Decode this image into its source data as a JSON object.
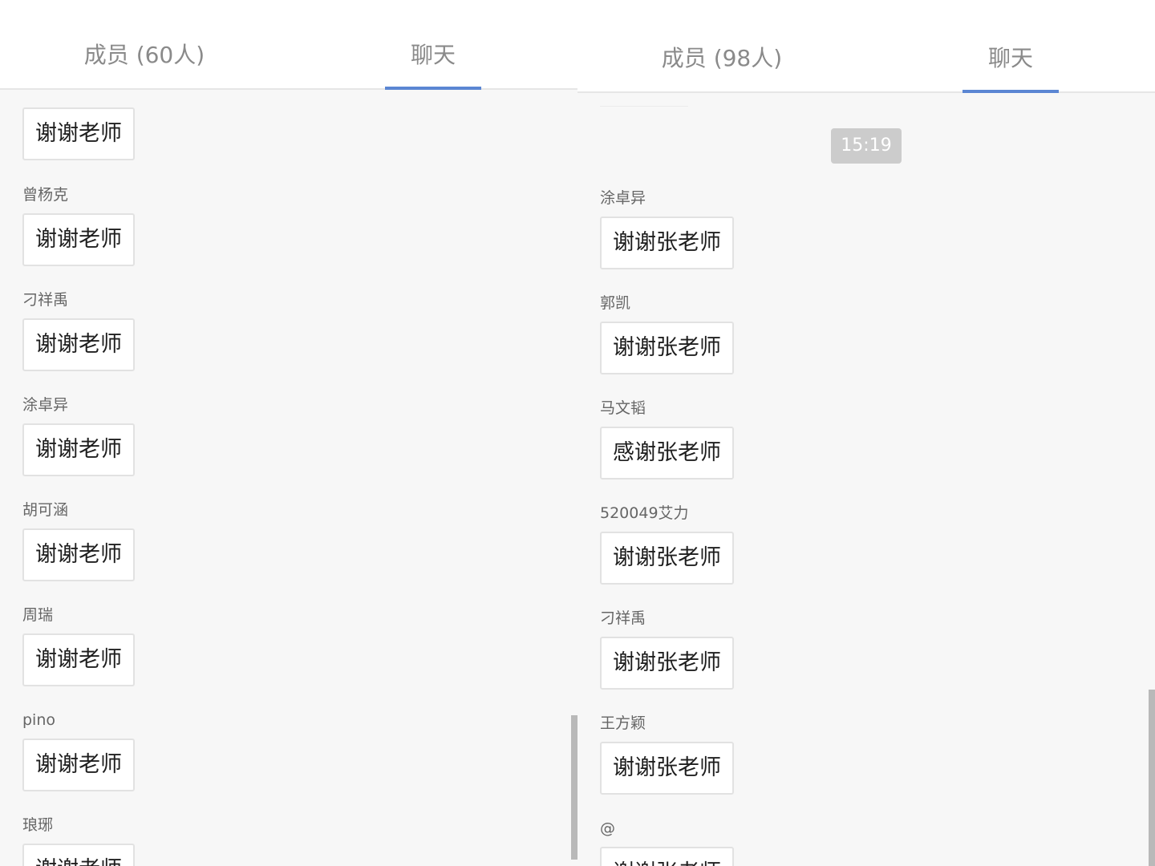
{
  "left": {
    "tabs": {
      "members_label": "成员 (60人)",
      "chat_label": "聊天",
      "active": "chat"
    },
    "first_bubble": "谢谢老师",
    "messages": [
      {
        "sender": "曾杨克",
        "text": "谢谢老师"
      },
      {
        "sender": "刁祥禹",
        "text": "谢谢老师"
      },
      {
        "sender": "涂卓异",
        "text": "谢谢老师"
      },
      {
        "sender": "胡可涵",
        "text": "谢谢老师"
      },
      {
        "sender": "周瑞",
        "text": "谢谢老师"
      },
      {
        "sender": "pino",
        "text": "谢谢老师"
      },
      {
        "sender": "琅琊",
        "text": "谢谢老师"
      }
    ]
  },
  "right": {
    "tabs": {
      "members_label": "成员 (98人)",
      "chat_label": "聊天",
      "active": "chat"
    },
    "time_label": "15:19",
    "messages": [
      {
        "sender": "涂卓异",
        "text": "谢谢张老师"
      },
      {
        "sender": "郭凯",
        "text": "谢谢张老师"
      },
      {
        "sender": "马文韬",
        "text": "感谢张老师"
      },
      {
        "sender": "520049艾力",
        "text": "谢谢张老师"
      },
      {
        "sender": "刁祥禹",
        "text": "谢谢张老师"
      },
      {
        "sender": "王方颖",
        "text": "谢谢张老师"
      },
      {
        "sender": "@",
        "text": "谢谢张老师"
      }
    ]
  },
  "colors": {
    "accent": "#5b86d3",
    "background": "#f7f7f7",
    "tab_text": "#8a8a8a",
    "time_badge": "#cccccc"
  }
}
